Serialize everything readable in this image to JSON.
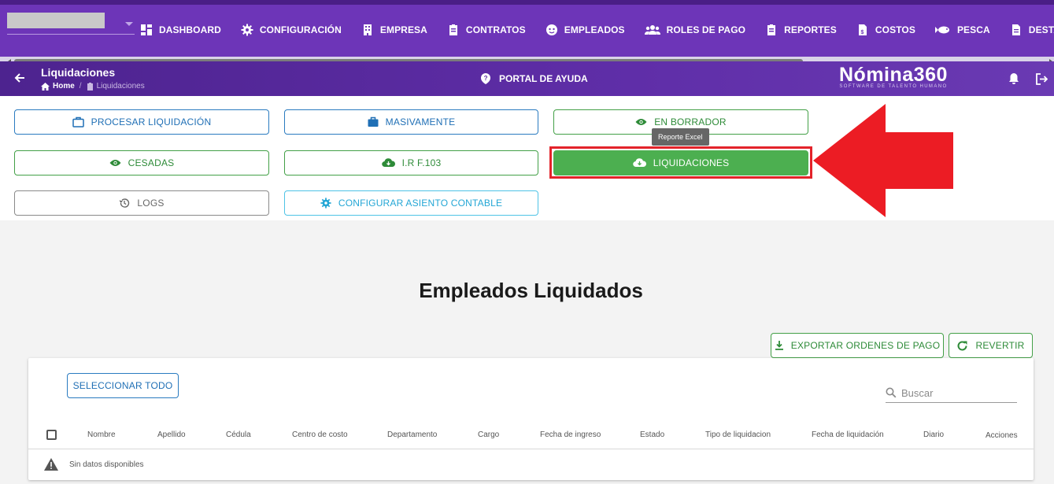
{
  "nav": {
    "items": [
      {
        "label": "DASHBOARD",
        "icon": "dashboard-icon"
      },
      {
        "label": "CONFIGURACIÓN",
        "icon": "gear-icon"
      },
      {
        "label": "EMPRESA",
        "icon": "building-icon"
      },
      {
        "label": "CONTRATOS",
        "icon": "clipboard-icon"
      },
      {
        "label": "EMPLEADOS",
        "icon": "face-icon"
      },
      {
        "label": "ROLES DE PAGO",
        "icon": "group-icon"
      },
      {
        "label": "REPORTES",
        "icon": "clipboard-icon"
      },
      {
        "label": "COSTOS",
        "icon": "file-dollar-icon"
      },
      {
        "label": "PESCA",
        "icon": "fish-icon"
      },
      {
        "label": "DESTAJO",
        "icon": "document-icon"
      }
    ]
  },
  "subheader": {
    "title": "Liquidaciones",
    "breadcrumb_home": "Home",
    "breadcrumb_current": "Liquidaciones",
    "help": "PORTAL DE AYUDA",
    "logo_name": "Nómina360",
    "logo_tagline": "SOFTWARE DE TALENTO HUMANO"
  },
  "actions": {
    "procesar": "PROCESAR LIQUIDACIÓN",
    "masivamente": "MASIVAMENTE",
    "borrador": "EN BORRADOR",
    "cesadas": "CESADAS",
    "irf": "I.R F.103",
    "liquidaciones": "LIQUIDACIONES",
    "logs": "LOGS",
    "asiento": "CONFIGURAR ASIENTO CONTABLE",
    "tooltip": "Reporte Excel"
  },
  "main": {
    "title": "Empleados Liquidados",
    "export": "EXPORTAR ORDENES DE PAGO",
    "revert": "REVERTIR",
    "select_all": "SELECCIONAR TODO",
    "search_placeholder": "Buscar",
    "columns": [
      "Nombre",
      "Apellido",
      "Cédula",
      "Centro de costo",
      "Departamento",
      "Cargo",
      "Fecha de ingreso",
      "Estado",
      "Tipo de liquidacion",
      "Fecha de liquidación",
      "Diario",
      "Acciones"
    ],
    "empty": "Sin datos disponibles"
  },
  "colors": {
    "brand": "#6d35b8",
    "accent_blue": "#1f6fb5",
    "accent_green": "#4caf50",
    "highlight": "#e3232a"
  }
}
